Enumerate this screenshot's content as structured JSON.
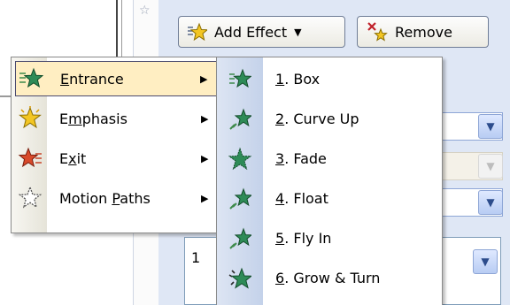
{
  "task_pane": {
    "add_effect": "Add Effect",
    "remove": "Remove",
    "list_item_number": "1"
  },
  "menu": {
    "items": [
      {
        "pre": "",
        "accel": "E",
        "post": "ntrance",
        "icon": "entrance-star-icon",
        "selected": true
      },
      {
        "pre": "E",
        "accel": "m",
        "post": "phasis",
        "icon": "emphasis-star-icon"
      },
      {
        "pre": "E",
        "accel": "x",
        "post": "it",
        "icon": "exit-star-icon"
      },
      {
        "pre": "Motion ",
        "accel": "P",
        "post": "aths",
        "icon": "motion-paths-star-icon"
      }
    ]
  },
  "submenu": {
    "items": [
      {
        "accel": "1",
        "post": ". Box",
        "icon": "box-effect-icon"
      },
      {
        "accel": "2",
        "post": ". Curve Up",
        "icon": "curve-up-effect-icon"
      },
      {
        "accel": "3",
        "post": ". Fade",
        "icon": "fade-effect-icon"
      },
      {
        "accel": "4",
        "post": ". Float",
        "icon": "float-effect-icon"
      },
      {
        "accel": "5",
        "post": ". Fly In",
        "icon": "fly-in-effect-icon"
      },
      {
        "accel": "6",
        "post": ". Grow & Turn",
        "icon": "grow-turn-effect-icon"
      }
    ]
  },
  "colors": {
    "menu_highlight": "#ffeec2",
    "task_pane_bg": "#dfe7f5",
    "star_green": "#2e8b57",
    "star_yellow": "#f3c623",
    "star_red": "#d84a2b"
  }
}
